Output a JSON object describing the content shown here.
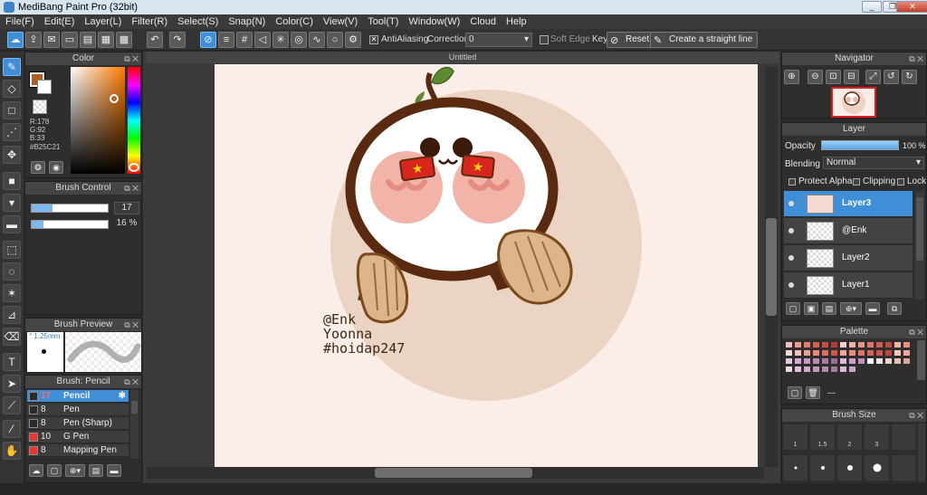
{
  "window": {
    "title": "MediBang Paint Pro (32bit)",
    "minimize": "_",
    "maximize": "❐",
    "close": "✕"
  },
  "menu": [
    "File(F)",
    "Edit(E)",
    "Layer(L)",
    "Filter(R)",
    "Select(S)",
    "Snap(N)",
    "Color(C)",
    "View(V)",
    "Tool(T)",
    "Window(W)",
    "Cloud",
    "Help"
  ],
  "toolbar": {
    "antialiasing_label": "AntiAliasing",
    "antialiasing_checked": "✕",
    "correction_label": "Correction",
    "correction_value": "0",
    "soft_edge_label": "Soft Edge",
    "key_label": "Key",
    "reset_label": "Reset",
    "straight_line_label": "Create a straight line"
  },
  "color_panel": {
    "title": "Color",
    "r": "R:178",
    "g": "G:92",
    "b": "B:33",
    "hex": "#B25C21",
    "foreground": "#B25C21"
  },
  "brush_control": {
    "title": "Brush Control",
    "size_value": "17",
    "size_level": 0.27,
    "opacity_value": "16 %",
    "opacity_level": 0.16
  },
  "brush_preview": {
    "title": "Brush Preview",
    "size_text": "1.25mm"
  },
  "brush_list": {
    "title": "Brush: Pencil",
    "items": [
      {
        "size": "17",
        "name": "Pencil",
        "color": "#2a2a2a",
        "selected": true
      },
      {
        "size": "8",
        "name": "Pen",
        "color": "#2a2a2a"
      },
      {
        "size": "8",
        "name": "Pen (Sharp)",
        "color": "#2a2a2a"
      },
      {
        "size": "10",
        "name": "G Pen",
        "color": "#e33"
      },
      {
        "size": "8",
        "name": "Mapping Pen",
        "color": "#e33"
      }
    ]
  },
  "document": {
    "tab_title": "Untitled",
    "artwork_text": {
      "line1": "@Enk",
      "line2": "Yoonna",
      "line3": "#hoidap247"
    }
  },
  "navigator": {
    "title": "Navigator",
    "icons": [
      "zoom-in",
      "zoom-out",
      "fit",
      "actual",
      "fullscreen",
      "rotate-left",
      "rotate-right",
      "flip"
    ]
  },
  "layer_panel": {
    "title": "Layer",
    "opacity_label": "Opacity",
    "opacity_value": "100 %",
    "blending_label": "Blending",
    "blending_value": "Normal",
    "protect_alpha_label": "Protect Alpha",
    "clipping_label": "Clipping",
    "lock_label": "Lock",
    "layers": [
      {
        "name": "Layer3",
        "selected": true
      },
      {
        "name": "@Enk"
      },
      {
        "name": "Layer2"
      },
      {
        "name": "Layer1"
      }
    ]
  },
  "palette_panel": {
    "title": "Palette",
    "dash": "---",
    "colors": [
      "#f3c1b8",
      "#f09a8b",
      "#e7796a",
      "#d85f52",
      "#c94e45",
      "#b03d38",
      "#f7d1c9",
      "#f2b3a6",
      "#eb9284",
      "#e07568",
      "#d25c52",
      "#c04943",
      "#f5b2a5",
      "#ee8f81",
      "#f8d9d2",
      "#f4c2b8",
      "#ef9f90",
      "#e9867a",
      "#e06c63",
      "#d6564f",
      "#f3a89a",
      "#ec8b7d",
      "#e47466",
      "#d9625a",
      "#cf524d",
      "#c3433f",
      "#f6c8bd",
      "#f0a698",
      "#e7c6e0",
      "#d7acd4",
      "#c89ac7",
      "#b98ab9",
      "#a97aaa",
      "#9a6c9c",
      "#e0b8d8",
      "#cfa2cb",
      "#c191bc",
      "#ffffff",
      "#f6e7e3",
      "#efd4cd",
      "#e6bfb5",
      "#d8a89d",
      "#f2d6e6",
      "#e4bfd9",
      "#d5aacb",
      "#c599bd",
      "#b489af",
      "#a378a1",
      "#d9bdd0",
      "#c9a8c2"
    ]
  },
  "brush_size_panel": {
    "title": "Brush Size",
    "labels": [
      "1",
      "1.5",
      "2",
      "3"
    ]
  }
}
